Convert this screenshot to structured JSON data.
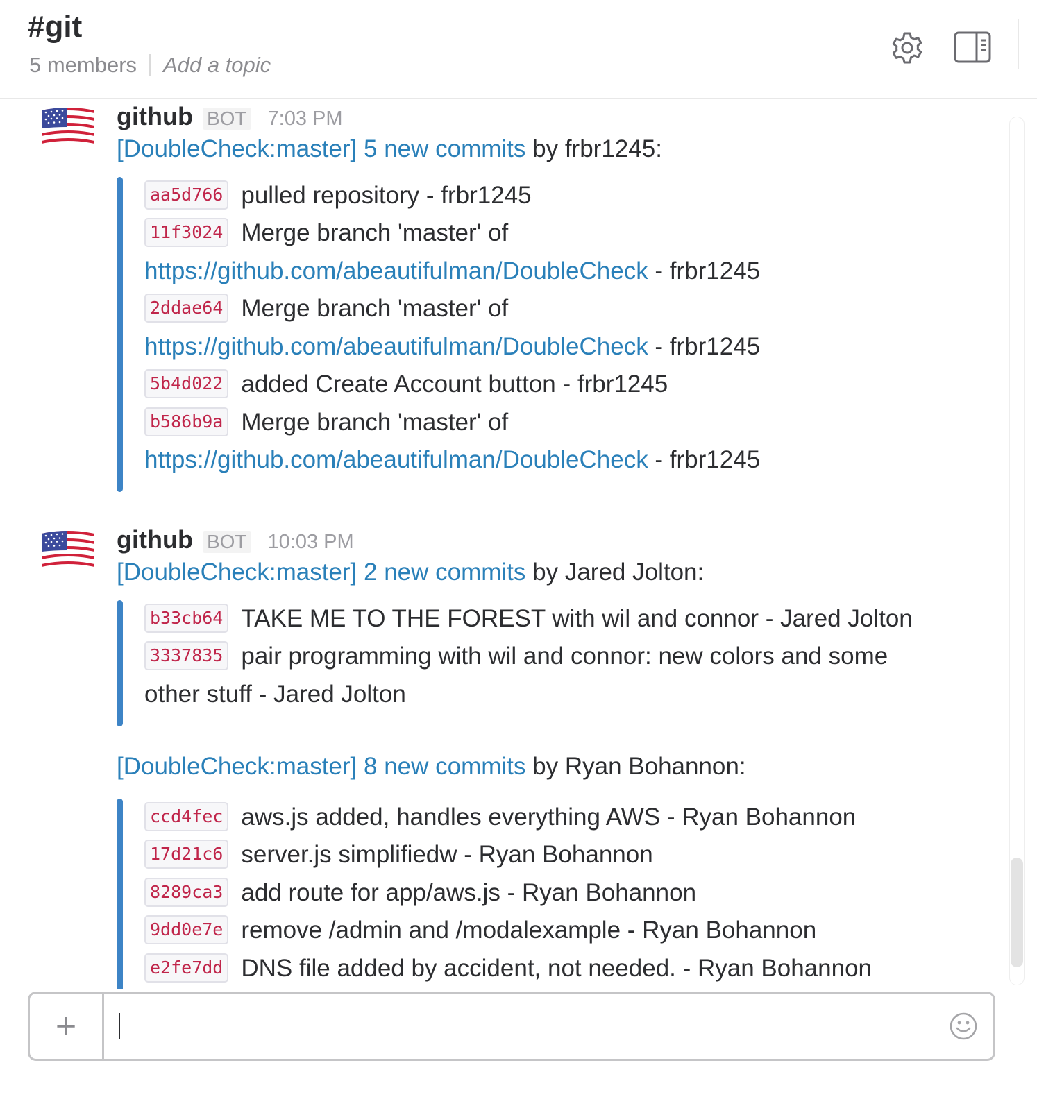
{
  "header": {
    "channel_name": "#git",
    "members": "5 members",
    "topic_placeholder": "Add a topic"
  },
  "icons": {
    "settings": "gear-icon",
    "details": "sidebar-panel-icon",
    "add": "plus-icon",
    "emoji": "smiley-icon",
    "avatar": "us-flag-icon"
  },
  "colors": {
    "link": "#2a80b9",
    "attachment_bar": "#3d84c6",
    "sha": "#c0254a"
  },
  "messages": [
    {
      "sender": "github",
      "badge": "BOT",
      "time": "7:03 PM",
      "repo": "[DoubleCheck:master]",
      "new_commits": "5 new commits",
      "by": "by frbr1245:",
      "lines": [
        {
          "sha": "aa5d766",
          "text": "pulled repository - frbr1245"
        },
        {
          "sha": "11f3024",
          "text": "Merge branch 'master' of"
        },
        {
          "link": "https://github.com/abeautifulman/DoubleCheck",
          "text": " - frbr1245"
        },
        {
          "sha": "2ddae64",
          "text": "Merge branch 'master' of"
        },
        {
          "link": "https://github.com/abeautifulman/DoubleCheck",
          "text": " - frbr1245"
        },
        {
          "sha": "5b4d022",
          "text": "added Create Account button - frbr1245"
        },
        {
          "sha": "b586b9a",
          "text": "Merge branch 'master' of"
        },
        {
          "link": "https://github.com/abeautifulman/DoubleCheck",
          "text": " - frbr1245"
        }
      ]
    },
    {
      "sender": "github",
      "badge": "BOT",
      "time": "10:03 PM",
      "repo": "[DoubleCheck:master]",
      "new_commits": "2 new commits",
      "by": "by Jared Jolton:",
      "lines": [
        {
          "sha": "b33cb64",
          "text": "TAKE ME TO THE FOREST with wil and connor - Jared Jolton"
        },
        {
          "sha": "3337835",
          "text": "pair programming with wil and connor: new colors and some"
        },
        {
          "text": "other stuff - Jared Jolton"
        }
      ]
    },
    {
      "repo": "[DoubleCheck:master]",
      "new_commits": "8 new commits",
      "by": "by Ryan Bohannon:",
      "lines": [
        {
          "sha": "ccd4fec",
          "text": "aws.js added, handles everything AWS - Ryan Bohannon"
        },
        {
          "sha": "17d21c6",
          "text": "server.js simplifiedw - Ryan Bohannon"
        },
        {
          "sha": "8289ca3",
          "text": "add route for app/aws.js - Ryan Bohannon"
        },
        {
          "sha": "9dd0e7e",
          "text": "remove /admin and /modalexample - Ryan Bohannon"
        },
        {
          "sha": "e2fe7dd",
          "text": "DNS file added by accident, not needed. - Ryan Bohannon"
        }
      ]
    }
  ],
  "composer": {
    "add_label": "+",
    "value": ""
  }
}
